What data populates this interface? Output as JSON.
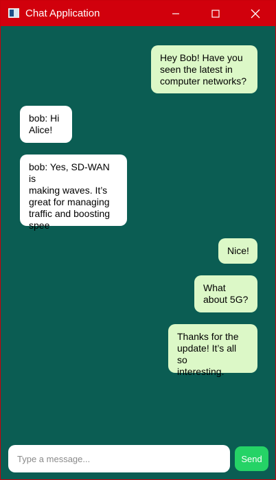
{
  "window": {
    "title": "Chat Application",
    "icon": "app-window-icon",
    "controls": [
      "minimize-icon",
      "maximize-icon",
      "close-icon"
    ]
  },
  "messages": [
    {
      "sender": "me",
      "text": " Hey Bob! Have you\nseen the latest in\ncomputer networks?"
    },
    {
      "sender": "bob",
      "text": "bob:  Hi\nAlice!"
    },
    {
      "sender": "bob",
      "text": "bob: Yes, SD-WAN is\nmaking waves. It’s\ngreat for managing\ntraffic and boosting\nspee"
    },
    {
      "sender": "me",
      "text": "Nice!"
    },
    {
      "sender": "me",
      "text": "What\nabout 5G?"
    },
    {
      "sender": "me",
      "text": "Thanks for the\nupdate! It’s all so\ninteresting."
    }
  ],
  "composer": {
    "placeholder": "Type a message...",
    "value": "",
    "send_label": "Send"
  },
  "colors": {
    "titlebar": "#d1000c",
    "background": "#0b5d53",
    "my_bubble": "#dcf8c7",
    "their_bubble": "#ffffff",
    "send_button": "#25d366"
  }
}
